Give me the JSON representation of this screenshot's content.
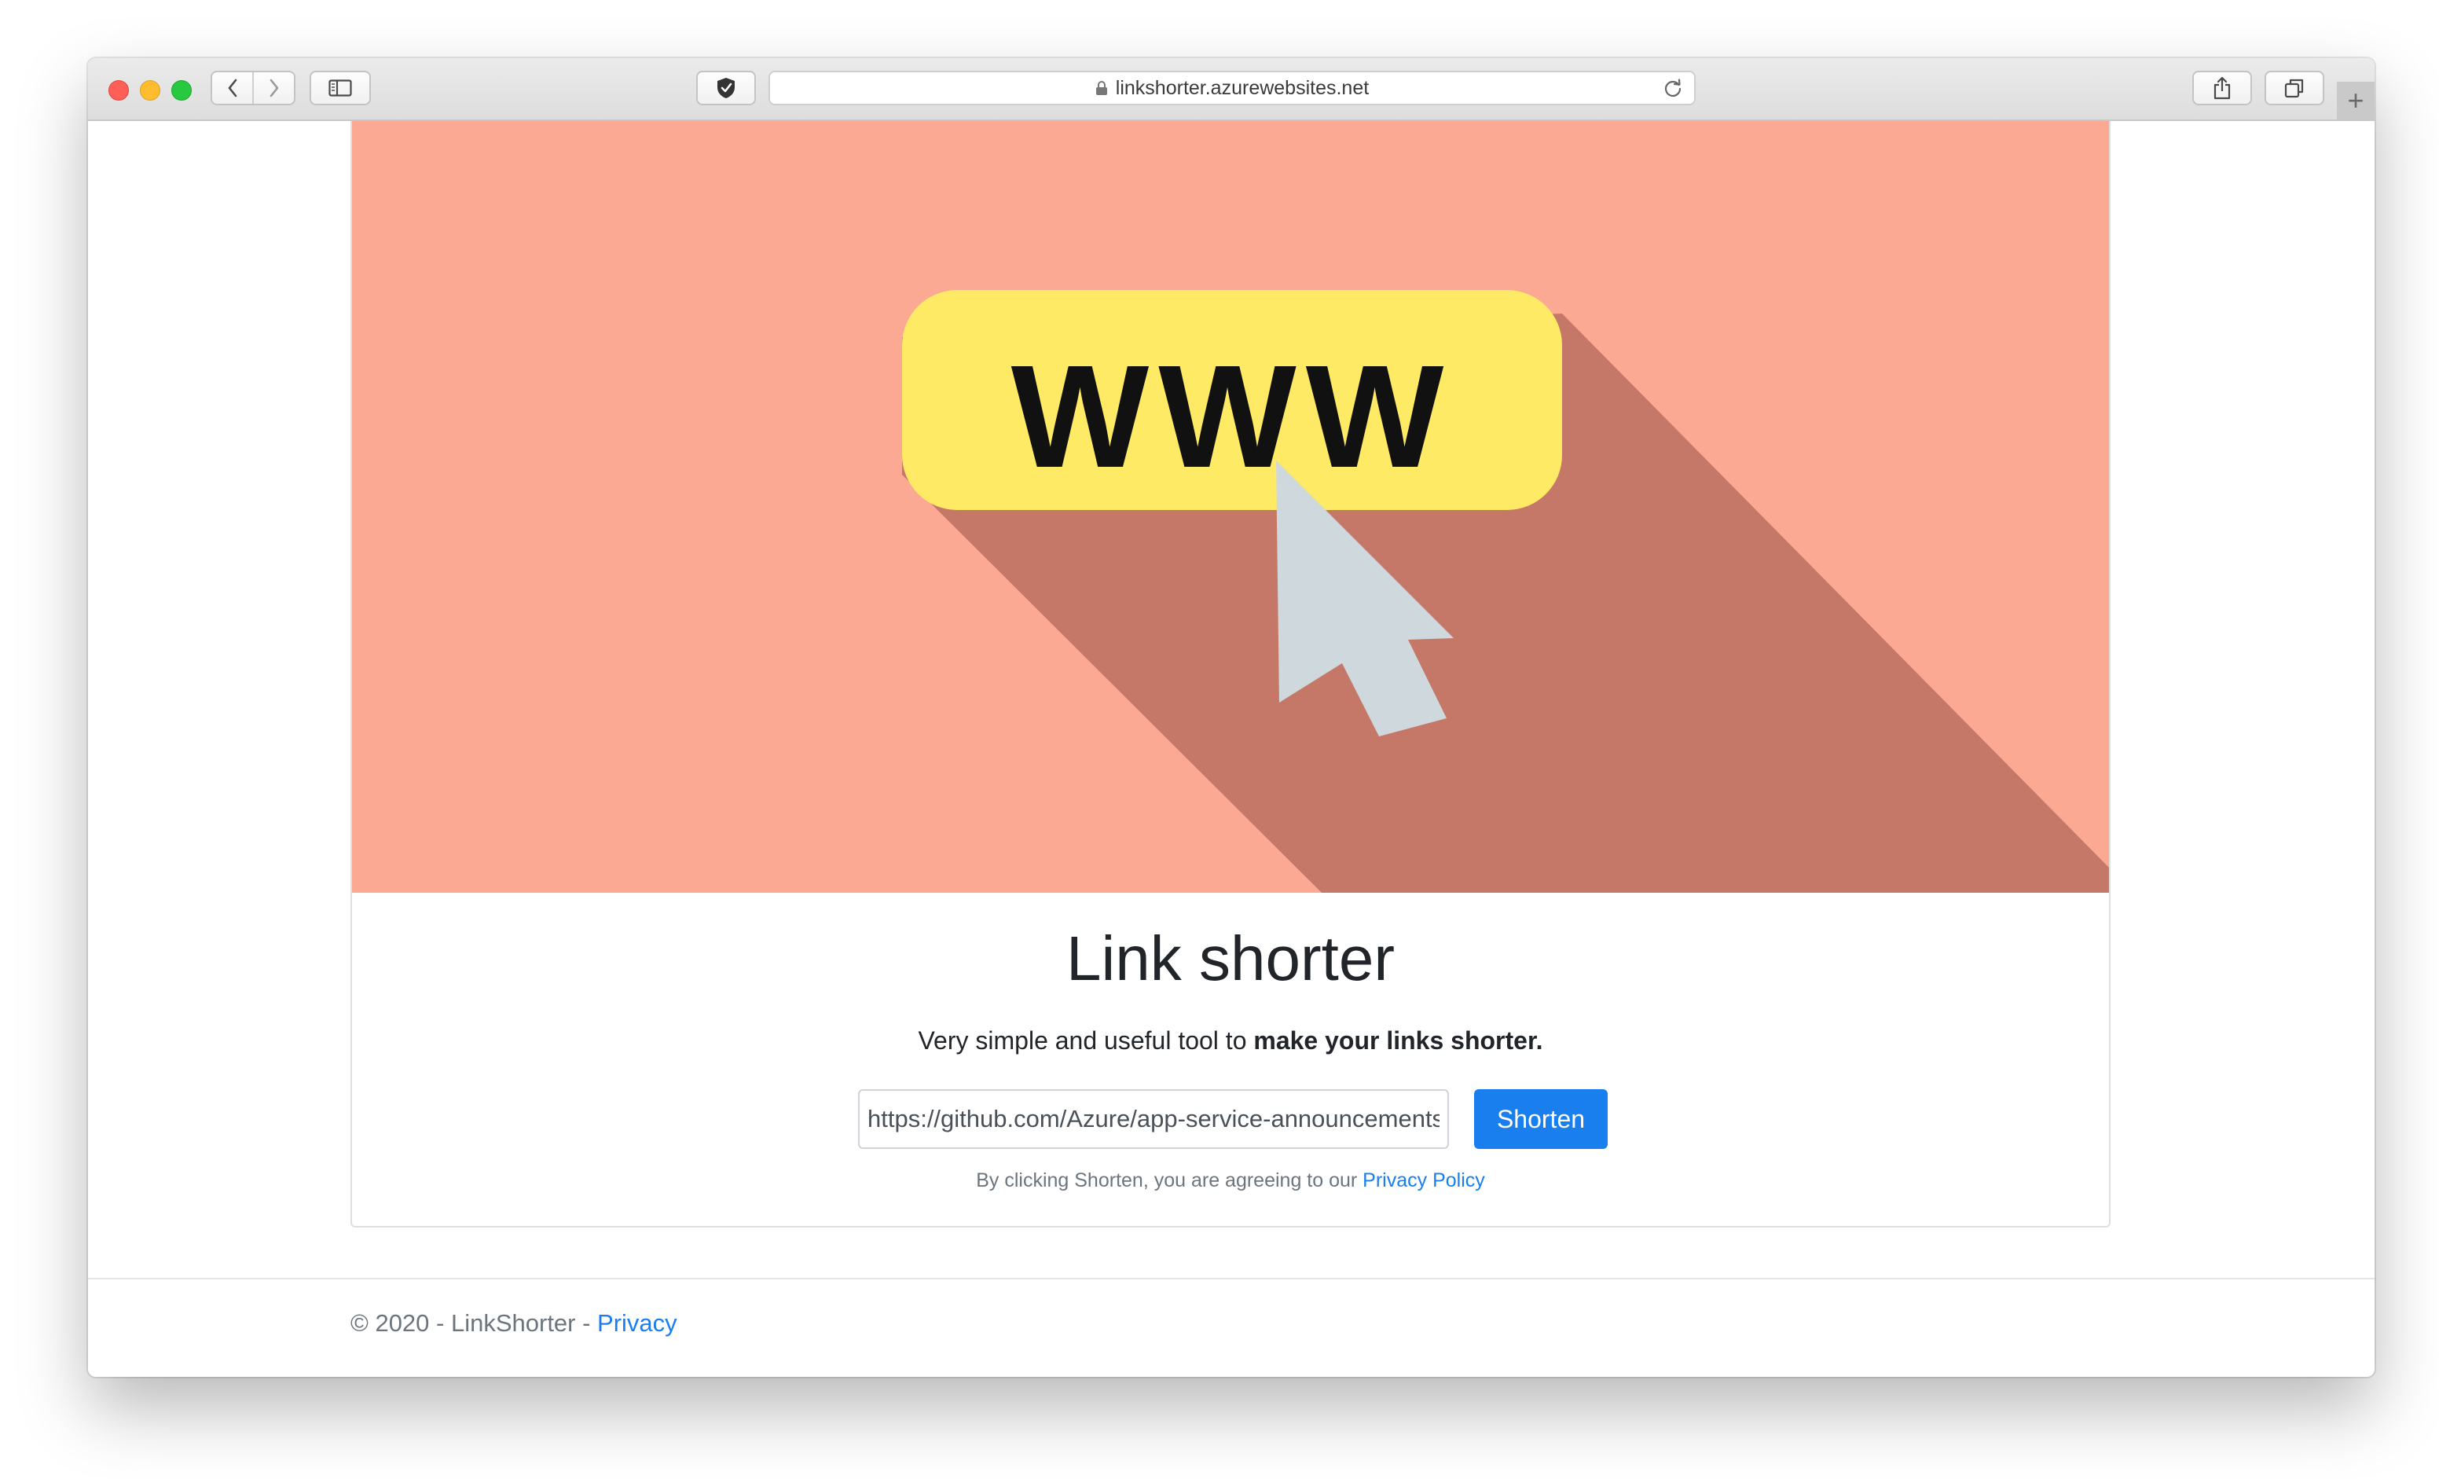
{
  "browser": {
    "url": "linkshorter.azurewebsites.net",
    "new_tab_symbol": "+"
  },
  "hero": {
    "image_text": "WWW",
    "colors": {
      "background": "#fca994",
      "shadow": "#c57867",
      "pill": "#feea64",
      "cursor": "#cfd8dc"
    }
  },
  "page": {
    "title": "Link shorter",
    "subtitle_prefix": "Very simple and useful tool to ",
    "subtitle_bold": "make your links shorter.",
    "url_input_value": "https://github.com/Azure/app-service-announcements",
    "shorten_button": "Shorten",
    "agree_prefix": "By clicking Shorten, you are agreeing to our ",
    "agree_link": "Privacy Policy"
  },
  "footer": {
    "text": "© 2020 - LinkShorter - ",
    "privacy_link": "Privacy"
  },
  "icons": [
    "back-icon",
    "forward-icon",
    "sidebar-icon",
    "shield-icon",
    "lock-icon",
    "reload-icon",
    "share-icon",
    "tabs-icon"
  ],
  "accent_color": "#1a7fee"
}
